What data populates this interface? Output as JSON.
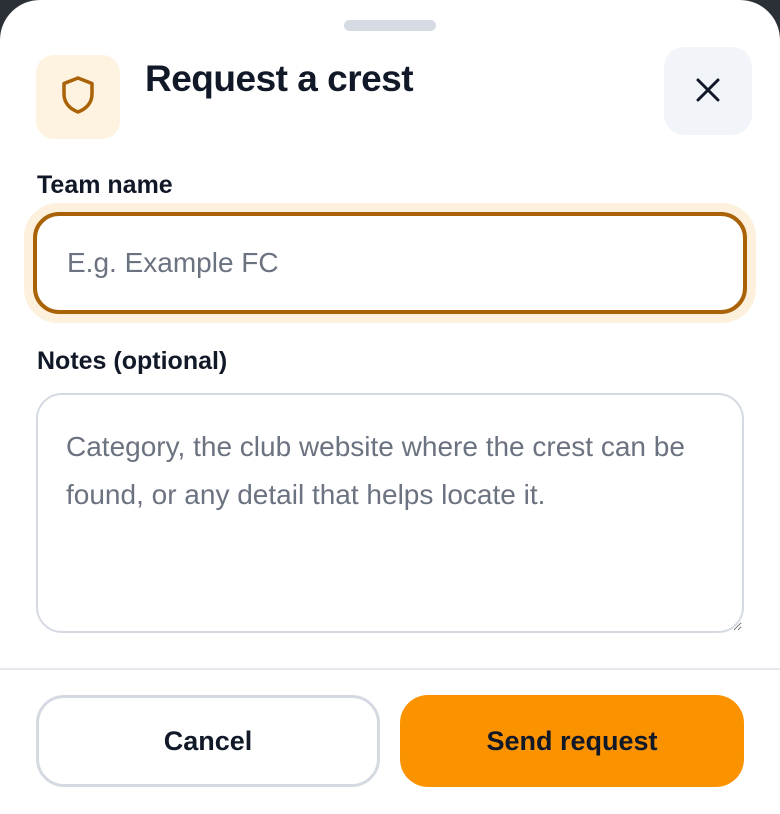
{
  "dialog": {
    "title": "Request a crest",
    "header_icon": "shield-icon",
    "close_icon": "close-icon"
  },
  "form": {
    "team_name": {
      "label": "Team name",
      "value": "",
      "placeholder": "E.g. Example FC"
    },
    "notes": {
      "label": "Notes (optional)",
      "value": "",
      "placeholder": "Category, the club website where the crest can be found, or any detail that helps locate it."
    }
  },
  "actions": {
    "cancel_label": "Cancel",
    "send_label": "Send request"
  },
  "colors": {
    "accent": "#fb9300",
    "focus_border": "#a96206",
    "icon_bg": "#fef3e0",
    "icon_stroke": "#a96206"
  }
}
